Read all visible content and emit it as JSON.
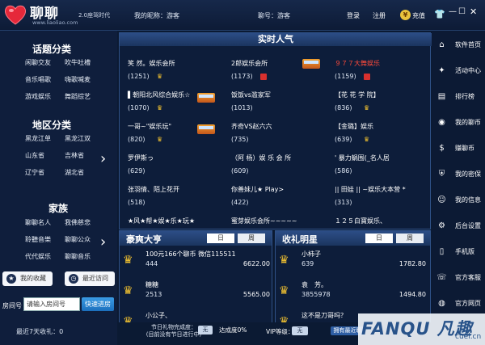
{
  "app": {
    "name": "聊聊",
    "subtitle": "2.0座驾时代",
    "url": "www.liaoliao.com"
  },
  "header": {
    "nickname_label": "我的昵称：",
    "nickname": "游客",
    "room_label": "聊号：",
    "room": "游客",
    "login": "登录",
    "register": "注册",
    "recharge": "充值",
    "coin_symbol": "¥"
  },
  "left": {
    "topic_title": "话题分类",
    "topics": [
      "闲聊交友",
      "吹牛吐槽",
      "音乐唱歌",
      "嗨歌喊麦",
      "游戏娱乐",
      "舞蹈综艺"
    ],
    "region_title": "地区分类",
    "regions": [
      "黑龙江单",
      "黑龙江双",
      "山东省",
      "吉林省",
      "辽宁省",
      "湖北省"
    ],
    "family_title": "家族",
    "families": [
      "聊聊名人",
      "我佛慈悲",
      "聆聽音樂",
      "聊聊公众",
      "代代娱乐",
      "聊聊音乐"
    ],
    "favorites": "我的收藏",
    "recent": "最近访问",
    "room_no_label": "房间号",
    "room_input_placeholder": "请输入房间号",
    "enter_button": "快速进房",
    "recent_income": "最近7天收礼：0"
  },
  "center": {
    "title": "实时人气",
    "rooms": [
      {
        "name": "笑 然。娱乐会所",
        "count": "(1251)"
      },
      {
        "name": "2郎娱乐会所",
        "count": "(1173)"
      },
      {
        "name": "９７７大舞娱乐",
        "count": "(1159)"
      },
      {
        "name": "▌朝阳北风综合娱乐☆",
        "count": "(1070)"
      },
      {
        "name": "饭饭vs滥家军",
        "count": "(1013)"
      },
      {
        "name": "【花 花 学 院】",
        "count": "(836)"
      },
      {
        "name": "一哥~\"娱乐玩\"",
        "count": "(820)"
      },
      {
        "name": "齐奇VS赵六六",
        "count": "(735)"
      },
      {
        "name": "【金璐】娱乐",
        "count": "(639)"
      },
      {
        "name": "罗伊斯っ",
        "count": "(629)"
      },
      {
        "name": "（阿 杨）娱 乐 会 所",
        "count": "(609)"
      },
      {
        "name": "' 暴力蜗围(_名人居",
        "count": "(586)"
      },
      {
        "name": "张羽倩、陌上花开",
        "count": "(518)"
      },
      {
        "name": "你善妹儿★ Play>",
        "count": "(422)"
      },
      {
        "name": "|| 田娃 || ~娱乐大本营 *",
        "count": "(313)"
      },
      {
        "name": "★风★帮★娱★乐★玩★",
        "count": "(219)"
      },
      {
        "name": "蜜芽娱乐会所~~~~~",
        "count": "(218)"
      },
      {
        "name": "１２５白寶娱乐、",
        "count": "(211)"
      }
    ]
  },
  "rich": {
    "title": "豪爽大亨",
    "tab_day": "日",
    "tab_week": "周",
    "rows": [
      {
        "name": "100元166个聊币 微信115511",
        "id": "444",
        "value": "6622.00"
      },
      {
        "name": "糖糖",
        "id": "2513",
        "value": "5565.00"
      },
      {
        "name": "小公子、",
        "id": "",
        "value": ""
      }
    ]
  },
  "gift": {
    "title": "收礼明星",
    "tab_day": "日",
    "tab_week": "周",
    "rows": [
      {
        "name": "小柿子",
        "id": "639",
        "value": "1782.80"
      },
      {
        "name": "袁　芳。",
        "id": "3855978",
        "value": "1494.80"
      },
      {
        "name": "这不是刀哥吗？",
        "id": "",
        "value": ""
      }
    ]
  },
  "status": {
    "festival": "节日礼物完成度：\n(目前没有节日进行中)",
    "none": "无",
    "completion": "达成度0%",
    "vip_label": "VIP等级：",
    "mine": "拥有最近聊"
  },
  "rightmenu": [
    {
      "icon": "home-icon",
      "glyph": "⌂",
      "label": "软件首页"
    },
    {
      "icon": "activity-icon",
      "glyph": "✦",
      "label": "活动中心"
    },
    {
      "icon": "ranking-icon",
      "glyph": "▤",
      "label": "排行榜"
    },
    {
      "icon": "coin-icon",
      "glyph": "◉",
      "label": "我的聊币"
    },
    {
      "icon": "earn-coin-icon",
      "glyph": "$",
      "label": "赚聊币"
    },
    {
      "icon": "security-icon",
      "glyph": "⛨",
      "label": "我的密保"
    },
    {
      "icon": "info-icon",
      "glyph": "☺",
      "label": "我的信息"
    },
    {
      "icon": "backend-icon",
      "glyph": "⚙",
      "label": "后台设置"
    },
    {
      "icon": "mobile-icon",
      "glyph": "▯",
      "label": "手机版"
    },
    {
      "icon": "service-icon",
      "glyph": "☏",
      "label": "官方客服"
    },
    {
      "icon": "website-icon",
      "glyph": "◍",
      "label": "官方网页"
    }
  ],
  "watermark": {
    "text": "FANQU 凡趣",
    "sub": "cuel.cn"
  },
  "colors": {
    "accent": "#1c6fbd",
    "gold": "#f2c230",
    "background": "#0b1a33"
  }
}
